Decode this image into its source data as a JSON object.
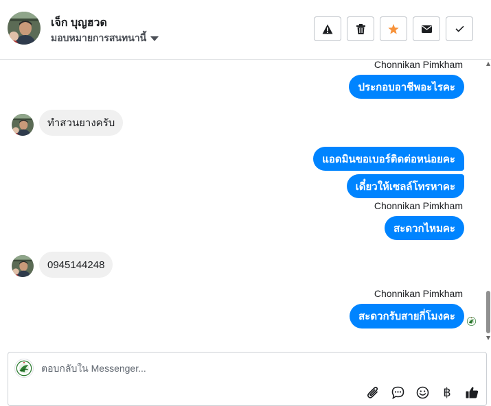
{
  "header": {
    "name": "เจ็ก บุญฮวด",
    "assign_label": "มอบหมายการสนทนานี้",
    "actions": [
      {
        "icon": "warning-icon"
      },
      {
        "icon": "trash-icon"
      },
      {
        "icon": "star-icon",
        "color": "#f7923a"
      },
      {
        "icon": "envelope-icon"
      },
      {
        "icon": "check-icon"
      }
    ]
  },
  "messages": [
    {
      "sender": "Chonnikan Pimkham",
      "text": "ประกอบอาชีพอะไรคะ"
    },
    {
      "text": "ทำสวนยางครับ"
    },
    {
      "text": "แอดมินขอเบอร์ติดต่อหน่อยคะ"
    },
    {
      "text": "เดี๋ยวให้เซลล์โทรหาคะ"
    },
    {
      "sender": "Chonnikan Pimkham",
      "text": "สะดวกไหมคะ"
    },
    {
      "text": "0945144248"
    },
    {
      "sender": "Chonnikan Pimkham",
      "text": "สะดวกรับสายกี่โมงคะ"
    }
  ],
  "composer": {
    "placeholder": "ตอบกลับใน Messenger...",
    "tools": [
      "paperclip-icon",
      "chat-bubble-icon",
      "emoji-icon",
      "baht-icon",
      "thumbs-up-icon"
    ],
    "baht_glyph": "฿"
  },
  "colors": {
    "outgoing_bubble": "#0084ff",
    "incoming_bubble": "#f0f0f0",
    "star": "#f7923a"
  }
}
